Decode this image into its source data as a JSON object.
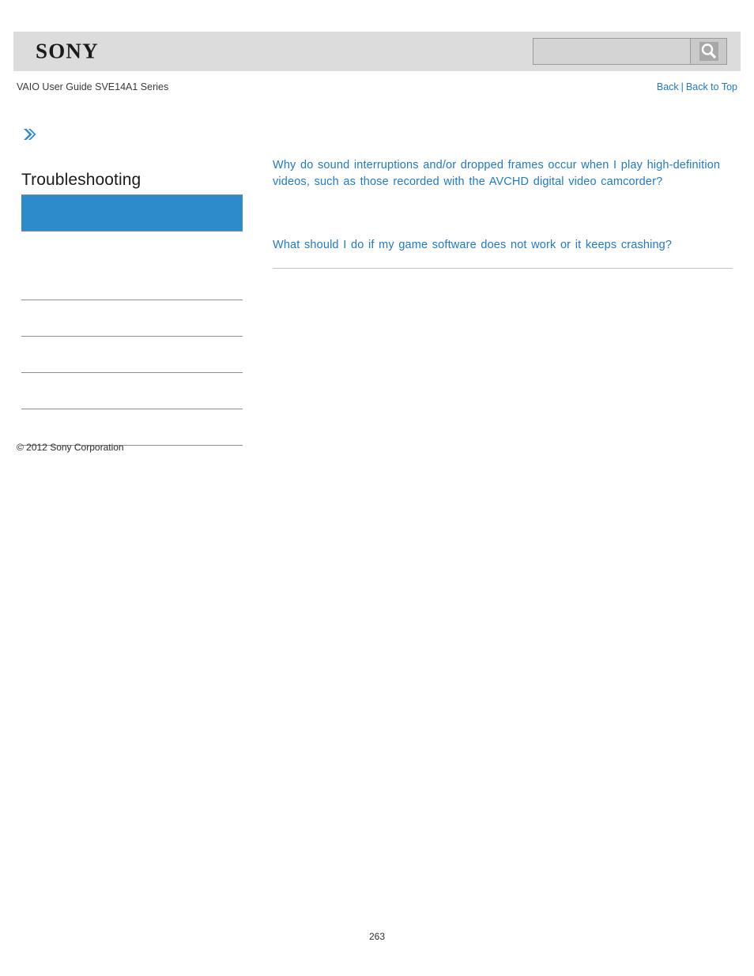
{
  "header": {
    "logo_text": "SONY",
    "logo_icon": "sony-wordmark"
  },
  "search": {
    "value": "",
    "placeholder": "",
    "button_icon": "search-icon"
  },
  "breadcrumb": {
    "document_title": "VAIO User Guide SVE14A1 Series"
  },
  "top_nav": {
    "back_label": "Back",
    "separator": "|",
    "back_to_top_label": "Back to Top"
  },
  "sidebar": {
    "expand_icon": "double-chevron-right-icon",
    "section_title": "Troubleshooting",
    "active_item": {
      "label": ""
    },
    "items": [
      {
        "label": ""
      },
      {
        "label": ""
      },
      {
        "label": ""
      },
      {
        "label": ""
      },
      {
        "label": ""
      }
    ]
  },
  "main": {
    "links": [
      {
        "label": "Why do sound interruptions and/or dropped frames occur when I play high-definition videos, such as those recorded with the AVCHD digital video camcorder?"
      },
      {
        "label": "What should I do if my game software does not work or it keeps crashing?"
      }
    ]
  },
  "footer": {
    "copyright": "© 2012 Sony Corporation",
    "page_number": "263"
  },
  "colors": {
    "accent_blue": "#2e8bcb",
    "link_blue": "#2079c9",
    "header_gray": "#dcdcdc",
    "rule_gray": "#8f8f8f"
  }
}
